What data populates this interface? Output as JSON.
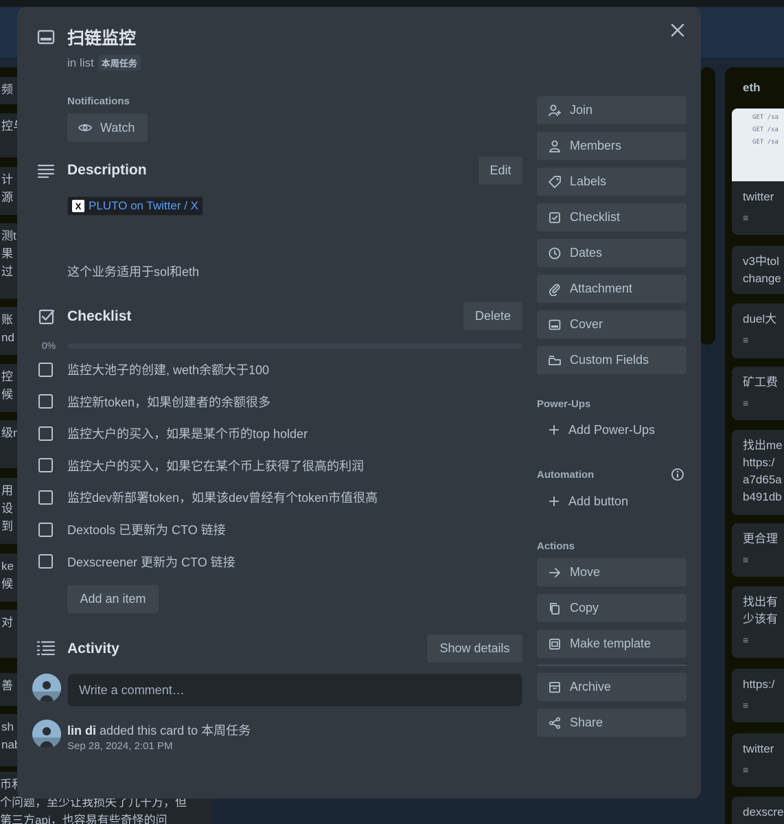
{
  "background": {
    "left_cards": [
      "频",
      "控与",
      "计",
      "源",
      "测t",
      "果",
      "过",
      "账",
      "nd",
      "控",
      "候",
      "级n",
      "用",
      "设",
      "到",
      "ke",
      "候",
      "对",
      "善",
      "sh",
      "nab"
    ],
    "bottom_text": [
      "币和",
      "个问题，至少让我损失了几千万，但",
      "第三方api，也容易有些奇怪的问"
    ],
    "right_list_title": "eth",
    "right_cards": [
      "twitter",
      "v3中tol",
      "change",
      "duel大",
      "矿工费",
      "找出me",
      "https:/",
      "a7d65a",
      "b491db",
      "更合理",
      "找出有",
      "少该有",
      "https:/",
      "twitter",
      "dexscre"
    ],
    "thumb_lines": [
      "GET /sa",
      "GET /sa",
      "GET /sa"
    ]
  },
  "card": {
    "title": "扫链监控",
    "in_list_prefix": "in list",
    "list_name": "本周任务"
  },
  "notifications": {
    "label": "Notifications",
    "watch_label": "Watch"
  },
  "description": {
    "title": "Description",
    "edit_label": "Edit",
    "link_text": "PLUTO on Twitter / X",
    "link_logo": "X",
    "text": "这个业务适用于sol和eth"
  },
  "checklist": {
    "title": "Checklist",
    "delete_label": "Delete",
    "progress_label": "0%",
    "progress": 0,
    "items": [
      "监控大池子的创建, weth余额大于100",
      "监控新token，如果创建者的余额很多",
      "监控大户的买入，如果是某个币的top holder",
      "监控大户的买入，如果它在某个币上获得了很高的利润",
      "监控dev新部署token，如果该dev曾经有个token市值很高",
      "Dextools 已更新为 CTO 链接",
      "Dexscreener 更新为 CTO 链接"
    ],
    "add_item_label": "Add an item"
  },
  "activity": {
    "title": "Activity",
    "show_details_label": "Show details",
    "comment_placeholder": "Write a comment…",
    "entry_user": "lin di",
    "entry_action": "added this card to 本周任务",
    "entry_time": "Sep 28, 2024, 2:01 PM"
  },
  "sidebar": {
    "add_to_card": [
      "Join",
      "Members",
      "Labels",
      "Checklist",
      "Dates",
      "Attachment",
      "Cover",
      "Custom Fields"
    ],
    "powerups_title": "Power-Ups",
    "add_powerups_label": "Add Power-Ups",
    "automation_title": "Automation",
    "add_button_label": "Add button",
    "actions_title": "Actions",
    "actions": [
      "Move",
      "Copy",
      "Make template"
    ],
    "archive_label": "Archive",
    "share_label": "Share"
  },
  "colors": {
    "modal_bg": "#323940",
    "button_bg": "#3d454d",
    "link": "#579dff",
    "text": "#b6c2cf"
  }
}
